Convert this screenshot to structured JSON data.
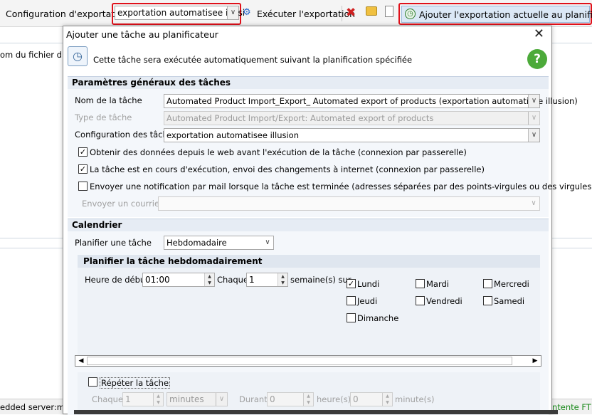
{
  "toolbar": {
    "config_label": "Configuration d'exportation",
    "config_value": "exportation automatisee illusi",
    "run_label": "Exécuter l'exportation",
    "add_to_scheduler_label": "Ajouter l'exportation actuelle au planificateur"
  },
  "background": {
    "left_text": "om du fichier d'expo",
    "status_left": "edded server:mag",
    "status_right": "ntente FTP e"
  },
  "dialog": {
    "title": "Ajouter une tâche au planificateur",
    "info": "Cette tâche sera exécutée automatiquement suivant la planification spécifiée",
    "general": {
      "section_title": "Paramètres généraux des tâches",
      "task_name_label": "Nom de la tâche",
      "task_name_value": "Automated Product Import_Export_ Automated export of products (exportation automatisee illusion)",
      "task_type_label": "Type de tâche",
      "task_type_value": "Automated Product Import/Export: Automated export of products",
      "task_config_label": "Configuration des tâches",
      "task_config_value": "exportation automatisee illusion",
      "check1_label": "Obtenir des données depuis le web avant l'exécution de la tâche (connexion par passerelle)",
      "check2_label": "La tâche est en cours d'exécution, envoi des changements à internet (connexion par passerelle)",
      "check3_label": "Envoyer une notification par mail lorsque la tâche est terminée (adresses séparées par des points-virgules ou des virgules)",
      "email_label": "Envoyer un courriel à",
      "email_value": ""
    },
    "calendar": {
      "section_title": "Calendrier",
      "schedule_label": "Planifier une tâche",
      "schedule_value": "Hebdomadaire",
      "weekly_title": "Planifier la tâche hebdomadairement",
      "start_label": "Heure de début",
      "start_value": "01:00",
      "every_label": "Chaque",
      "every_value": "1",
      "weeks_label": "semaine(s) sur",
      "days": {
        "mon": "Lundi",
        "tue": "Mardi",
        "wed": "Mercredi",
        "thu": "Jeudi",
        "fri": "Vendredi",
        "sat": "Samedi",
        "sun": "Dimanche"
      },
      "checked_days": [
        "Lundi"
      ],
      "repeat_label": "Répéter la tâche",
      "repeat_every_label": "Chaque",
      "repeat_every_value": "1",
      "repeat_unit": "minutes",
      "duration_label": "Durant",
      "duration_hours": "0",
      "hours_label": "heure(s)",
      "duration_minutes": "0",
      "minutes_label": "minute(s)"
    }
  },
  "colors": {
    "highlight_red": "#e0101a",
    "section_bg": "#e6ecf4",
    "status_green": "#1a8a1a"
  }
}
